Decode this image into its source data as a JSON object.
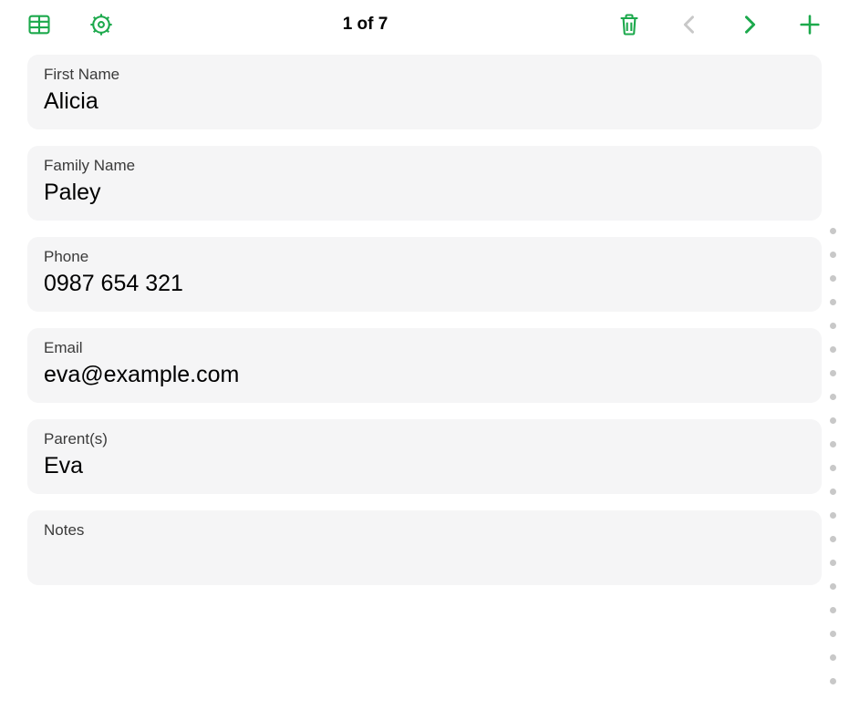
{
  "accent_color": "#1ca94c",
  "toolbar": {
    "pagination": "1 of 7",
    "icons": {
      "table": "table-grid-icon",
      "settings": "gear-icon",
      "delete": "trash-icon",
      "prev": "chevron-left-icon",
      "next": "chevron-right-icon",
      "add": "plus-icon"
    },
    "prev_disabled": true,
    "next_disabled": false
  },
  "fields": [
    {
      "key": "first_name",
      "label": "First Name",
      "value": "Alicia"
    },
    {
      "key": "family_name",
      "label": "Family Name",
      "value": "Paley"
    },
    {
      "key": "phone",
      "label": "Phone",
      "value": "0987 654 321"
    },
    {
      "key": "email",
      "label": "Email",
      "value": "eva@example.com"
    },
    {
      "key": "parents",
      "label": "Parent(s)",
      "value": "Eva"
    },
    {
      "key": "notes",
      "label": "Notes",
      "value": ""
    }
  ],
  "scroll_indicator_dots": 20
}
